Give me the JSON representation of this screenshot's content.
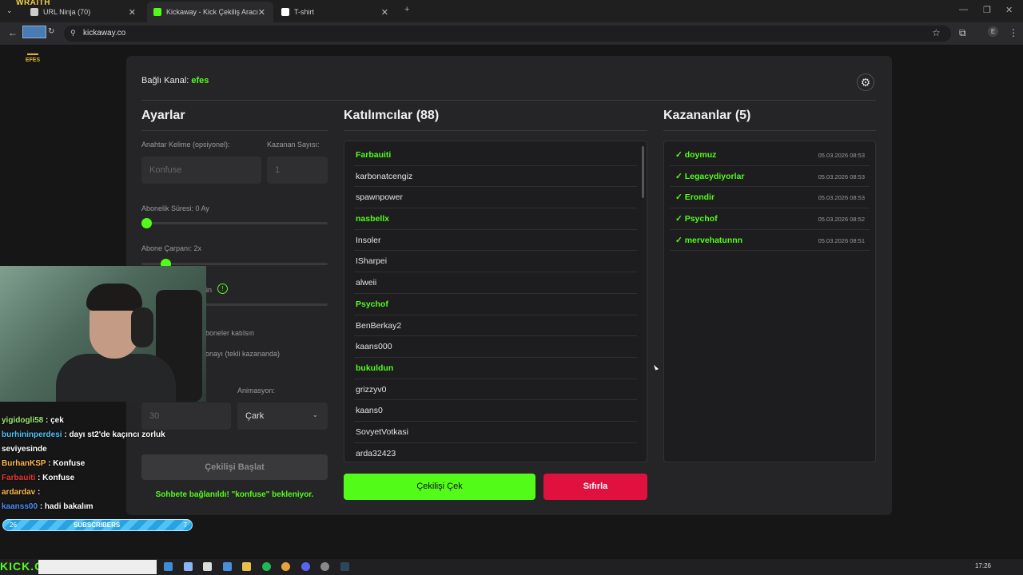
{
  "browser": {
    "overlay_brand": "WRAITH",
    "tabs": [
      {
        "label": "URL Ninja (70)"
      },
      {
        "label": "Kickaway - Kick Çekiliş Aracı"
      },
      {
        "label": "T-shirt"
      }
    ],
    "url": "kickaway.co"
  },
  "stream_logo": "EFES",
  "page": {
    "channel_label": "Bağlı Kanal:",
    "channel_name": "efes",
    "settings": {
      "title": "Ayarlar",
      "keyword_label": "Anahtar Kelime (opsiyonel):",
      "keyword_placeholder": "Konfuse",
      "winner_count_label": "Kazanan Sayısı:",
      "winner_count_value": "1",
      "sub_duration_label": "Abonelik Süresi: 0 Ay",
      "sub_duration_value": 0,
      "sub_multiplier_label": "Abone Çarpanı: 2x",
      "sub_multiplier_value": 2,
      "partial_label_1": "ün",
      "partial_label_2": "boneler katılsın",
      "partial_label_3": "onayı (tekli kazananda)",
      "timer_value": "30",
      "animation_label": "Animasyon:",
      "animation_value": "Çark",
      "start_button": "Çekilişi Başlat",
      "status": "Sohbete bağlanıldı! \"konfuse\" bekleniyor."
    },
    "participants": {
      "title": "Katılımcılar (88)",
      "items": [
        {
          "name": "Farbauiti",
          "sub": true
        },
        {
          "name": "karbonatcengiz",
          "sub": false
        },
        {
          "name": "spawnpower",
          "sub": false
        },
        {
          "name": "nasbellx",
          "sub": true
        },
        {
          "name": "Insoler",
          "sub": false
        },
        {
          "name": "ISharpei",
          "sub": false
        },
        {
          "name": "alweii",
          "sub": false
        },
        {
          "name": "Psychof",
          "sub": true
        },
        {
          "name": "BenBerkay2",
          "sub": false
        },
        {
          "name": "kaans000",
          "sub": false
        },
        {
          "name": "bukuldun",
          "sub": true
        },
        {
          "name": "grizzyv0",
          "sub": false
        },
        {
          "name": "kaans0",
          "sub": false
        },
        {
          "name": "SovyetVotkasi",
          "sub": false
        },
        {
          "name": "arda32423",
          "sub": false
        }
      ],
      "draw_button": "Çekilişi Çek",
      "reset_button": "Sıfırla"
    },
    "winners": {
      "title": "Kazananlar (5)",
      "items": [
        {
          "name": "✓ doymuz",
          "date": "05.03.2026 08:53"
        },
        {
          "name": "✓ Legacydiyorlar",
          "date": "05.03.2026 08:53"
        },
        {
          "name": "✓ Erondir",
          "date": "05.03.2026 08:53"
        },
        {
          "name": "✓ Psychof",
          "date": "05.03.2026 08:52"
        },
        {
          "name": "✓ mervehatunnn",
          "date": "05.03.2026 08:51"
        }
      ]
    }
  },
  "chat": [
    {
      "user": "yigidogli58",
      "msg": ": çek",
      "color": "#9be870"
    },
    {
      "user": "burhininperdesi",
      "msg": ": dayı st2'de kaçıncı zorluk seviyesinde",
      "color": "#4fc3f7"
    },
    {
      "user": "BurhanKSP",
      "msg": ": Konfuse",
      "color": "#ffb74d"
    },
    {
      "user": "Farbauiti",
      "msg": ": Konfuse",
      "color": "#e53935"
    },
    {
      "user": "ardardav",
      "msg": ":",
      "color": "#ffb74d"
    },
    {
      "user": "kaanss00",
      "msg": ": hadi bakalım",
      "color": "#4f8cf7"
    }
  ],
  "subs_bar": {
    "left": "26",
    "label": "SUBSCRIBERS",
    "right": "7"
  },
  "taskbar": {
    "kick_text": "KICK.COM/EFES",
    "clock": "17:26"
  },
  "colors": {
    "accent": "#53fc18",
    "danger": "#e0113f",
    "panel": "#252527",
    "bg": "#161617"
  }
}
